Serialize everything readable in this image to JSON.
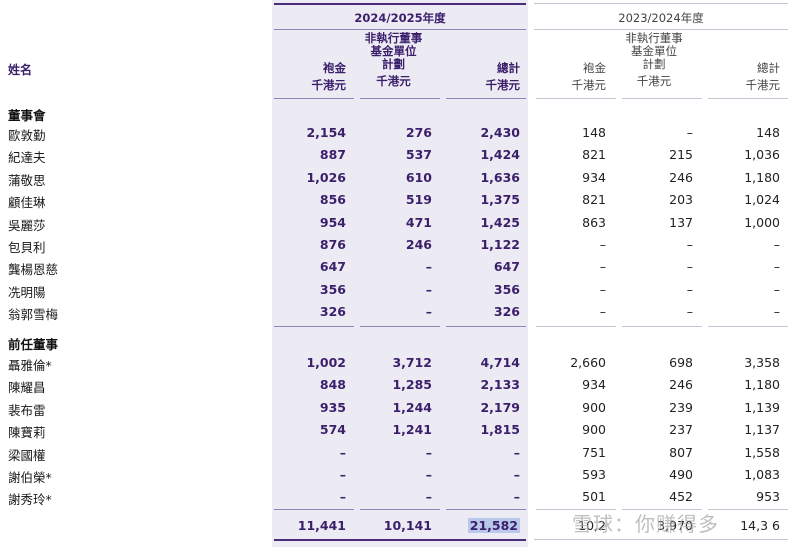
{
  "header": {
    "current_year": "2024/2025年度",
    "prev_year": "2023/2024年度",
    "name_label": "姓名",
    "columns": [
      "袍金",
      "非執行董事\n基金單位\n計劃",
      "總計"
    ],
    "unit": "千港元"
  },
  "sections": [
    {
      "title": "董事會",
      "rows": [
        {
          "name": "歐敦勤",
          "cur": [
            "2,154",
            "276",
            "2,430"
          ],
          "prev": [
            "148",
            "–",
            "148"
          ]
        },
        {
          "name": "紀達夫",
          "cur": [
            "887",
            "537",
            "1,424"
          ],
          "prev": [
            "821",
            "215",
            "1,036"
          ]
        },
        {
          "name": "蒲敬思",
          "cur": [
            "1,026",
            "610",
            "1,636"
          ],
          "prev": [
            "934",
            "246",
            "1,180"
          ]
        },
        {
          "name": "顧佳琳",
          "cur": [
            "856",
            "519",
            "1,375"
          ],
          "prev": [
            "821",
            "203",
            "1,024"
          ]
        },
        {
          "name": "吳麗莎",
          "cur": [
            "954",
            "471",
            "1,425"
          ],
          "prev": [
            "863",
            "137",
            "1,000"
          ]
        },
        {
          "name": "包貝利",
          "cur": [
            "876",
            "246",
            "1,122"
          ],
          "prev": [
            "–",
            "–",
            "–"
          ]
        },
        {
          "name": "龔楊恩慈",
          "cur": [
            "647",
            "–",
            "647"
          ],
          "prev": [
            "–",
            "–",
            "–"
          ]
        },
        {
          "name": "冼明陽",
          "cur": [
            "356",
            "–",
            "356"
          ],
          "prev": [
            "–",
            "–",
            "–"
          ]
        },
        {
          "name": "翁郭雪梅",
          "cur": [
            "326",
            "–",
            "326"
          ],
          "prev": [
            "–",
            "–",
            "–"
          ]
        }
      ]
    },
    {
      "title": "前任董事",
      "rows": [
        {
          "name": "聶雅倫*",
          "cur": [
            "1,002",
            "3,712",
            "4,714"
          ],
          "prev": [
            "2,660",
            "698",
            "3,358"
          ]
        },
        {
          "name": "陳耀昌",
          "cur": [
            "848",
            "1,285",
            "2,133"
          ],
          "prev": [
            "934",
            "246",
            "1,180"
          ]
        },
        {
          "name": "裴布雷",
          "cur": [
            "935",
            "1,244",
            "2,179"
          ],
          "prev": [
            "900",
            "239",
            "1,139"
          ]
        },
        {
          "name": "陳寶莉",
          "cur": [
            "574",
            "1,241",
            "1,815"
          ],
          "prev": [
            "900",
            "237",
            "1,137"
          ]
        },
        {
          "name": "梁國權",
          "cur": [
            "–",
            "–",
            "–"
          ],
          "prev": [
            "751",
            "807",
            "1,558"
          ]
        },
        {
          "name": "謝伯榮*",
          "cur": [
            "–",
            "–",
            "–"
          ],
          "prev": [
            "593",
            "490",
            "1,083"
          ]
        },
        {
          "name": "謝秀玲*",
          "cur": [
            "–",
            "–",
            "–"
          ],
          "prev": [
            "501",
            "452",
            "953"
          ]
        }
      ]
    }
  ],
  "totals": {
    "cur": [
      "11,441",
      "10,141",
      "21,582"
    ],
    "prev": [
      "10,2",
      "3,970",
      "14,3 6"
    ]
  },
  "watermark": "雪球：你赚得多",
  "colors": {
    "accent": "#4b2a7b",
    "shade": "#ecebf4",
    "highlight": "#b9c7ea"
  }
}
